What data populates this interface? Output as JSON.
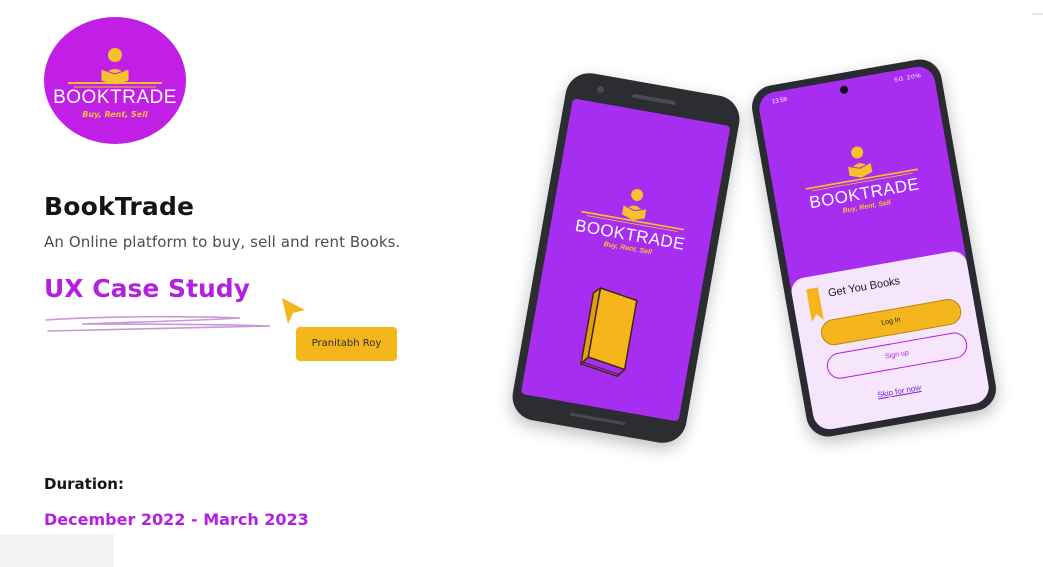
{
  "logo": {
    "word": "BOOKTRADE",
    "tagline": "Buy, Rent, Sell"
  },
  "hero": {
    "title": "BookTrade",
    "subtitle": "An Online platform to buy, sell and rent Books.",
    "case_study": "UX Case Study",
    "author": "Pranitabh Roy"
  },
  "duration": {
    "label": "Duration:",
    "value": "December 2022 - March 2023"
  },
  "phone_splash": {
    "word": "BOOKTRADE",
    "tagline": "Buy, Rent, Sell"
  },
  "phone_login": {
    "status_time": "13:59",
    "status_right": "5G 20%",
    "word": "BOOKTRADE",
    "tagline": "Buy, Rent, Sell",
    "sheet_title": "Get You Books",
    "login_label": "Log In",
    "signup_label": "Sign up",
    "skip_label": "Skip for now"
  },
  "colors": {
    "brand_purple": "#b321e0",
    "screen_purple": "#a72ef0",
    "accent_yellow": "#f5b51c"
  },
  "icons": [
    "reader-icon",
    "book-icon",
    "bookmark-icon",
    "cursor-icon"
  ]
}
